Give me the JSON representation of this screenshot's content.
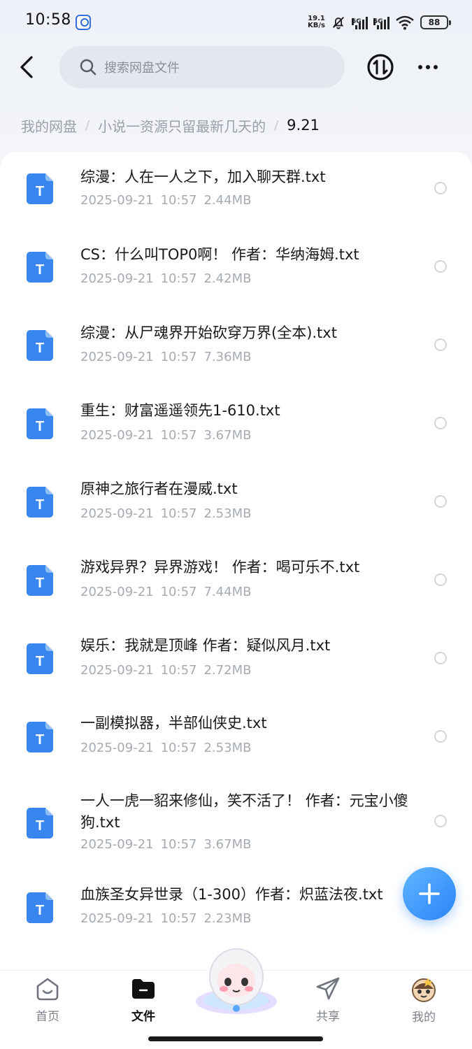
{
  "status_bar": {
    "time": "10:58",
    "net_speed_value": "19.1",
    "net_speed_unit": "KB/s",
    "sim1": "5G",
    "sim2": "5G",
    "battery": "88"
  },
  "header": {
    "search_placeholder": "搜索网盘文件",
    "icons": [
      "back-arrow-icon",
      "search-icon",
      "transfer-icon",
      "more-icon"
    ]
  },
  "breadcrumb": {
    "items": [
      "我的网盘",
      "小说一资源只留最新几天的"
    ],
    "current": "9.21"
  },
  "files": [
    {
      "name": "综漫：人在一人之下，加入聊天群.txt",
      "date": "2025-09-21",
      "time": "10:57",
      "size": "2.44MB"
    },
    {
      "name": "CS：什么叫TOP0啊！ 作者：华纳海姆.txt",
      "date": "2025-09-21",
      "time": "10:57",
      "size": "2.42MB"
    },
    {
      "name": "综漫：从尸魂界开始砍穿万界(全本).txt",
      "date": "2025-09-21",
      "time": "10:57",
      "size": "7.36MB"
    },
    {
      "name": "重生：财富遥遥领先1-610.txt",
      "date": "2025-09-21",
      "time": "10:57",
      "size": "3.67MB"
    },
    {
      "name": "原神之旅行者在漫威.txt",
      "date": "2025-09-21",
      "time": "10:57",
      "size": "2.53MB"
    },
    {
      "name": "游戏异界？异界游戏！ 作者：喝可乐不.txt",
      "date": "2025-09-21",
      "time": "10:57",
      "size": "7.44MB"
    },
    {
      "name": "娱乐：我就是顶峰 作者：疑似风月.txt",
      "date": "2025-09-21",
      "time": "10:57",
      "size": "2.72MB"
    },
    {
      "name": "一副模拟器，半部仙侠史.txt",
      "date": "2025-09-21",
      "time": "10:57",
      "size": "2.53MB"
    },
    {
      "name": "一人一虎一貂来修仙，笑不活了！ 作者：元宝小傻狗.txt",
      "date": "2025-09-21",
      "time": "10:57",
      "size": "3.67MB"
    },
    {
      "name": "血族圣女异世录（1-300）作者：炽蓝法夜.txt",
      "date": "2025-09-21",
      "time": "10:57",
      "size": "2.23MB"
    }
  ],
  "file_icon_letter": "T",
  "bottom_nav": {
    "items": [
      {
        "label": "首页",
        "icon": "home-icon",
        "active": false
      },
      {
        "label": "文件",
        "icon": "folder-icon",
        "active": true
      },
      {
        "label": "共享",
        "icon": "share-icon",
        "active": false
      },
      {
        "label": "我的",
        "icon": "profile-avatar-icon",
        "active": false
      }
    ]
  },
  "colors": {
    "accent": "#2b83f7",
    "file_icon": "#3a86f0",
    "muted_text": "#a6abb3"
  }
}
